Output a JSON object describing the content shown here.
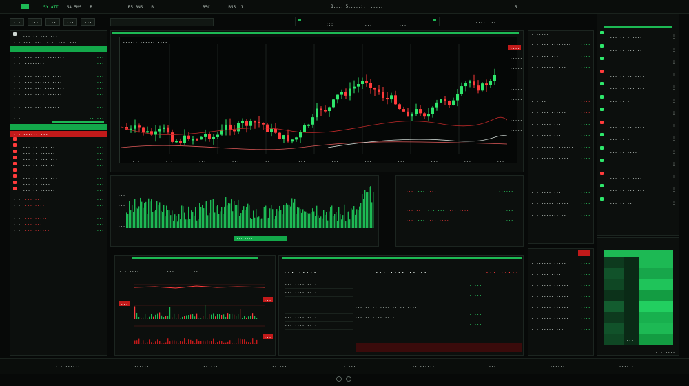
{
  "colors": {
    "up": "#2ee66b",
    "down": "#ff3b3b",
    "accent": "#1db954",
    "bg": "#070908"
  },
  "topbar": {
    "items": [
      "5Y ATT",
      "5A 5MS",
      "B...... ....",
      "B5 BNS",
      "B...... ...",
      "...",
      "B5C ...",
      "B55..1 ...."
    ],
    "center": "B.... 5.....:.. .....",
    "right": [
      "......",
      "........ ......",
      "5.... ...",
      "...... ......",
      "....... ...."
    ]
  },
  "toolbar": {
    "buttons": [
      "...",
      "...",
      "...",
      "...",
      "..."
    ],
    "center_left": ":::",
    "center_mid": "...",
    "center_right": "...",
    "right_btn": "....",
    "right_dots": "..."
  },
  "left": {
    "header": "... ...... ....",
    "tabs": [
      "... ...",
      "...",
      "...",
      "...",
      "..."
    ],
    "highlight": "... ...... ....",
    "rows": [
      {
        "a": "...",
        "b": "... .... .......",
        "c": "..."
      },
      {
        "a": "...",
        "b": "........",
        "c": "..."
      },
      {
        "a": "...",
        "b": "... .... .... ...",
        "c": "..."
      },
      {
        "a": "...",
        "b": "... ...... ....",
        "c": "..."
      },
      {
        "a": "...",
        "b": "... ...... ....",
        "c": "..."
      },
      {
        "a": "...",
        "b": "... ... .... ...",
        "c": "..."
      },
      {
        "a": "...",
        "b": "... .... ......",
        "c": "..."
      },
      {
        "a": "...",
        "b": "... ... .......",
        "c": "..."
      },
      {
        "a": "...",
        "b": "... ... ......",
        "c": "..."
      }
    ],
    "mid_label": "...",
    "mid_value": "... ...",
    "lower_header": "... ...... ....",
    "lower_tab": "... ...... ...",
    "lower_rows": [
      {
        "b": "... ......",
        "c": "..."
      },
      {
        "b": "... ...... ..",
        "c": "..."
      },
      {
        "b": "... .........",
        "c": "..."
      },
      {
        "b": "... ...... ...",
        "c": "..."
      },
      {
        "b": "... ...... ..",
        "c": "..."
      },
      {
        "b": "... ......",
        "c": "..."
      },
      {
        "b": "... ...... ....",
        "c": "..."
      },
      {
        "b": "... .......",
        "c": "..."
      },
      {
        "b": "... .........",
        "c": "..."
      }
    ],
    "bottom_rows": [
      {
        "a": "...",
        "b": "... ...",
        "c": "..."
      },
      {
        "a": "...",
        "b": "... ....",
        "c": "..."
      },
      {
        "a": "...",
        "b": "... ... ..",
        "c": "..."
      },
      {
        "a": "...",
        "b": "... .....",
        "c": "..."
      },
      {
        "a": "...",
        "b": "... ...",
        "c": "..."
      },
      {
        "a": "...",
        "b": "... ......",
        "c": "..."
      }
    ]
  },
  "main_chart": {
    "title": "...... ...... ....",
    "badge": "....",
    "yticks": [
      ".....",
      ".....",
      ".....",
      ".....",
      ".....",
      ".....",
      ".....",
      ".....",
      "....."
    ],
    "xticks": [
      "...",
      "...",
      "...",
      "...",
      "...",
      "...",
      "...",
      "...",
      "...",
      "...",
      "...",
      "..."
    ]
  },
  "volume": {
    "header": [
      "... ....",
      "...",
      "...",
      "...",
      "...",
      "...",
      "... ...."
    ],
    "yticks": [
      "...",
      "...",
      "...",
      "..."
    ],
    "xticks": [
      "...",
      "...",
      "...",
      "...",
      "...",
      "...",
      "..."
    ],
    "badge": "... ......"
  },
  "quotes": {
    "header": [
      "....",
      "....",
      "....",
      "....",
      "......"
    ],
    "rows": [
      {
        "a": "...",
        "b": "...",
        "c": "...",
        "d": "......"
      },
      {
        "a": "... ...",
        "b": "....",
        "c": "... ....",
        "d": "..."
      },
      {
        "a": "... ...",
        "b": "... ...",
        "c": "... ....",
        "d": "..."
      },
      {
        "a": "...",
        "b": "...",
        "c": "... ....",
        "d": "..."
      },
      {
        "a": "...",
        "b": "...",
        "c": "... .",
        "d": "..."
      }
    ]
  },
  "small_chart": {
    "header": "... ...... ....",
    "label_a": "... ....",
    "label_b": "...",
    "label_c": "...",
    "badge1": "...",
    "badge2": "...",
    "badge3": "..."
  },
  "orders": {
    "header": [
      "... ...... ....",
      "... ...... ....",
      "... ....",
      "... ...."
    ],
    "big": [
      "... .....",
      "... .... .. ..",
      "... ....."
    ],
    "rows": [
      "... .... ....",
      "... .... ....",
      "... .... ....",
      "... .... ....",
      "... .... ....",
      "... .... ...."
    ],
    "notes": [
      "... .... .. ...... ....",
      "... ..... ....... .. ....",
      "... ....... ...."
    ],
    "right_rows": [
      ".....",
      ".....",
      ".....",
      ".....",
      "....."
    ]
  },
  "right": {
    "header": ".......",
    "rows": [
      {
        "l": "... ... ........",
        "v": "....",
        "c": "g"
      },
      {
        "l": "... ... ...",
        "v": "....",
        "c": "g"
      },
      {
        "l": "... ...... ...",
        "v": "....",
        "c": "g"
      },
      {
        "l": "... ...... .....",
        "v": "....",
        "c": "g"
      },
      {
        "l": "... ....",
        "v": "....",
        "c": "g"
      },
      {
        "l": "... ..",
        "v": "....",
        "c": "r"
      },
      {
        "l": "... ... ......",
        "v": "....",
        "c": "r"
      },
      {
        "l": "... .... ...",
        "v": "....",
        "c": "g"
      },
      {
        "l": "... .... ...",
        "v": "....",
        "c": "g"
      },
      {
        "l": "... ...... ......",
        "v": "....",
        "c": "g"
      },
      {
        "l": "... ...... ....",
        "v": "....",
        "c": "g"
      },
      {
        "l": "... ... ....",
        "v": "....",
        "c": "g"
      },
      {
        "l": "... ..... ..",
        "v": "....",
        "c": "g"
      },
      {
        "l": "... .... ...",
        "v": "....",
        "c": "g"
      },
      {
        "l": "... ..... .....",
        "v": "....",
        "c": "g"
      },
      {
        "l": "... ....... ..",
        "v": "....",
        "c": "g"
      }
    ],
    "lower_header": "........ ....",
    "lower_badge": "....",
    "lower_rows": [
      {
        "l": "........ .....",
        "v": "...."
      },
      {
        "l": "... ... ....",
        "v": "...."
      },
      {
        "l": "... .... ......",
        "v": "...."
      },
      {
        "l": "... ..... .....",
        "v": "...."
      },
      {
        "l": "... .... ......",
        "v": "...."
      },
      {
        "l": "... .... ......",
        "v": "...."
      },
      {
        "l": "... ..... ...",
        "v": "...."
      },
      {
        "l": "... .... ...",
        "v": "...."
      }
    ]
  },
  "farright": {
    "header": "......",
    "rows": [
      "... .... ....",
      "... ...... ..",
      "... ....",
      "... ..... ....",
      "... ...... ....",
      "... ....",
      "... ...... ....",
      "... ..... .....",
      "... ....",
      "... .......",
      "... ...... ..",
      "... .... ....",
      "... ...... ....",
      "... ....."
    ],
    "lower_header": [
      "... .........",
      "... ......"
    ],
    "heat_header": "...",
    "heat_rows": [
      "....",
      "....",
      "....",
      "....",
      "....",
      "....",
      "....",
      "...."
    ],
    "footer": "... ...."
  },
  "bottom": {
    "items": [
      "... ......",
      "......",
      "......",
      "......",
      "......",
      "... ......",
      "...",
      "......",
      "......"
    ]
  }
}
